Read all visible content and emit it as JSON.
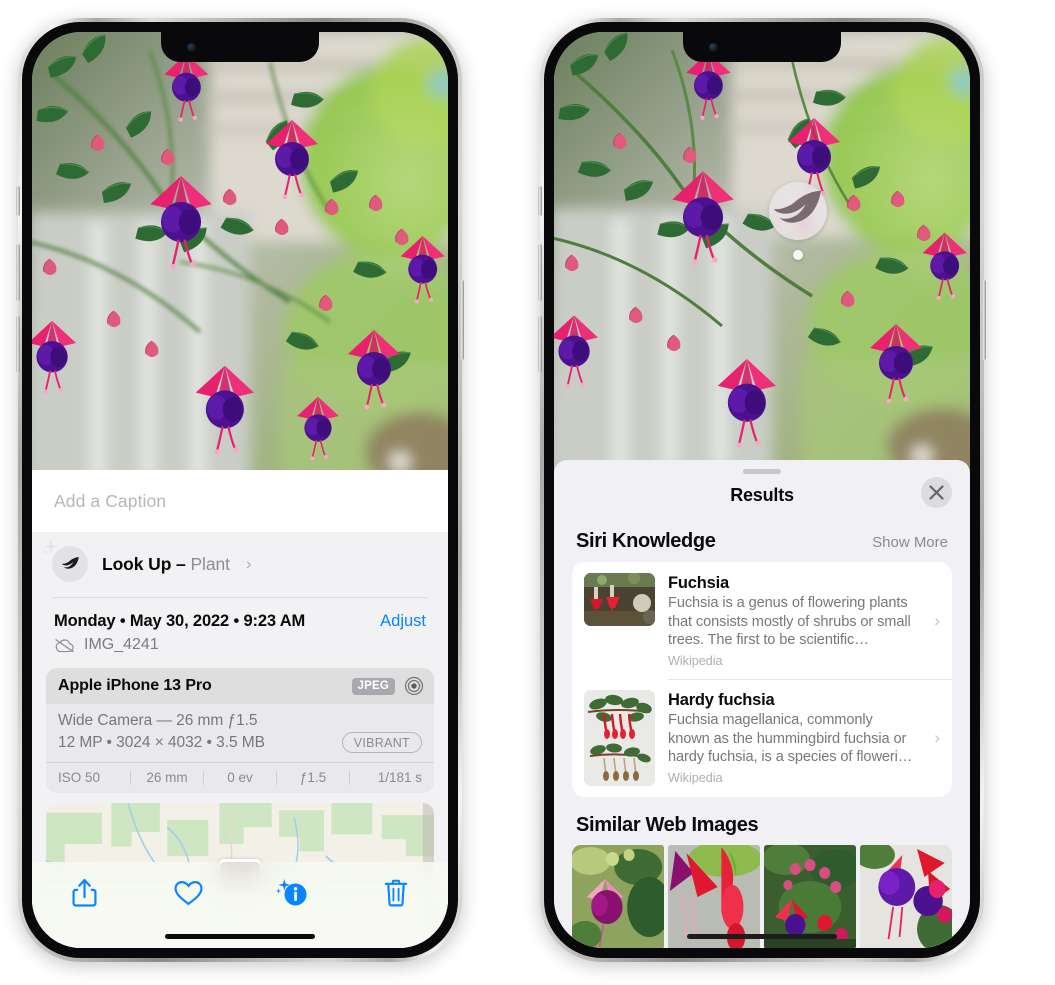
{
  "colors": {
    "accent_blue": "#0a84ff",
    "sheet_gray": "#f2f2f5",
    "card_gray": "#e8e8ed",
    "text_primary": "#0a0a0a",
    "text_secondary": "#77777d"
  },
  "left_phone": {
    "caption": {
      "placeholder": "Add a Caption",
      "value": ""
    },
    "lookup": {
      "icon": "leaf-icon",
      "sparkle_icon": "sparkle-icon",
      "label": "Look Up – ",
      "subject": "Plant",
      "chevron": "›"
    },
    "date_row": {
      "date": "Monday • May 30, 2022 • 9:23 AM",
      "adjust_label": "Adjust"
    },
    "file_row": {
      "icon": "cloud-slash-icon",
      "filename": "IMG_4241"
    },
    "exif": {
      "device": "Apple iPhone 13 Pro",
      "format_badge": "JPEG",
      "aperture_icon": "aperture-icon",
      "lens_line": "Wide Camera — 26 mm ƒ1.5",
      "spec_line": "12 MP • 3024 × 4032 • 3.5 MB",
      "style_badge": "VIBRANT",
      "settings": [
        "ISO 50",
        "26 mm",
        "0 ev",
        "ƒ1.5",
        "1/181 s"
      ]
    },
    "map": {
      "pin_label": "photo-thumbnail-pin"
    },
    "toolbar": [
      {
        "name": "share-button",
        "icon": "share-icon"
      },
      {
        "name": "favorite-button",
        "icon": "heart-icon"
      },
      {
        "name": "info-button",
        "icon": "info-sparkle-icon"
      },
      {
        "name": "delete-button",
        "icon": "trash-icon"
      }
    ]
  },
  "right_phone": {
    "visual_lookup_badge": {
      "icon": "leaf-icon",
      "name": "visual-look-up-badge"
    },
    "sheet": {
      "title": "Results",
      "close_icon": "close-icon"
    },
    "siri_knowledge": {
      "section_title": "Siri Knowledge",
      "show_more_label": "Show More",
      "results": [
        {
          "title": "Fuchsia",
          "description": "Fuchsia is a genus of flowering plants that consists mostly of shrubs or small trees. The first to be scientific…",
          "source": "Wikipedia",
          "thumbnail": "red-fuchsia-flowers-thumbnail",
          "chevron": "›"
        },
        {
          "title": "Hardy fuchsia",
          "description": "Fuchsia magellanica, commonly known as the hummingbird fuchsia or hardy fuchsia, is a species of floweri…",
          "source": "Wikipedia",
          "thumbnail": "hardy-fuchsia-specimen-thumbnail",
          "chevron": "›"
        }
      ]
    },
    "similar_web_images": {
      "section_title": "Similar Web Images",
      "images": [
        {
          "name": "web-image-1",
          "alt": "pink and magenta fuchsia flower with leaves"
        },
        {
          "name": "web-image-2",
          "alt": "red and magenta fuchsia close-up"
        },
        {
          "name": "web-image-3",
          "alt": "fuchsia shrub with buds"
        },
        {
          "name": "web-image-4",
          "alt": "purple and red fuchsia blooms"
        }
      ]
    }
  }
}
